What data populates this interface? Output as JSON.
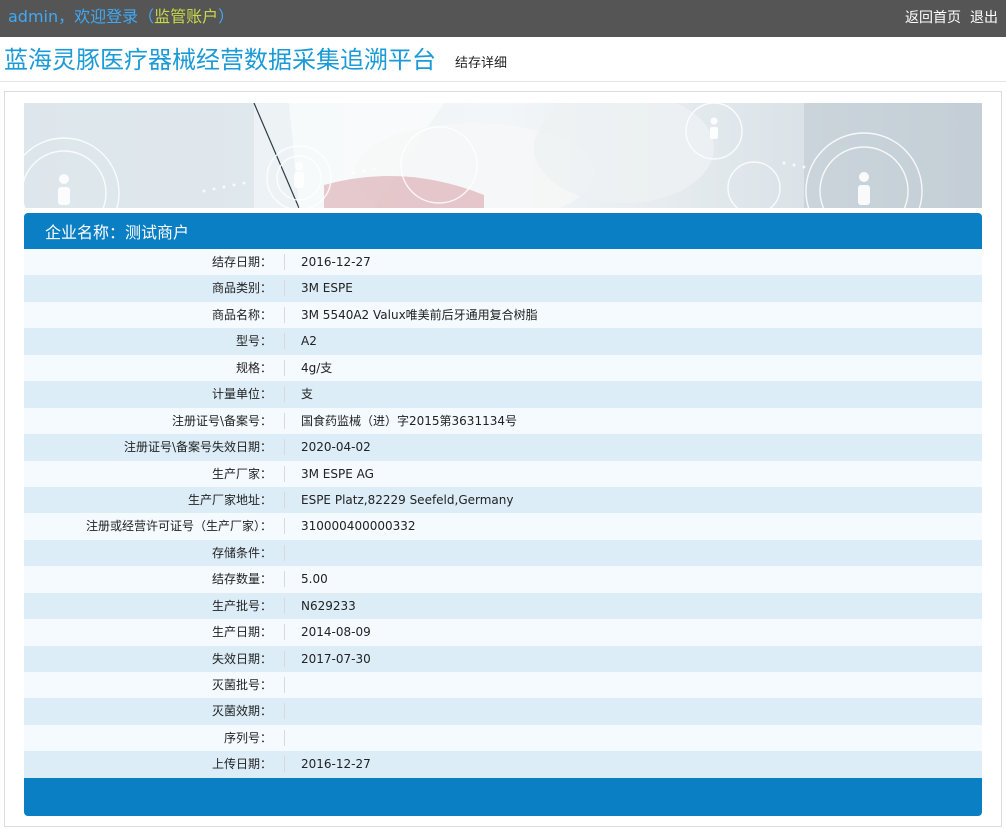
{
  "header": {
    "user": "admin",
    "welcome": "，欢迎登录（",
    "role": "监管账户",
    "role_close": "）",
    "home_link": "返回首页",
    "logout_link": "退出"
  },
  "title": {
    "site": "蓝海灵豚医疗器械经营数据采集追溯平台",
    "page": "结存详细"
  },
  "banner": {
    "icon": "person-circle-icon"
  },
  "panel": {
    "company_label": "企业名称：",
    "company_name": "测试商户",
    "rows": [
      {
        "label": "结存日期：",
        "value": "2016-12-27"
      },
      {
        "label": "商品类别：",
        "value": "3M ESPE"
      },
      {
        "label": "商品名称：",
        "value": "3M 5540A2 Valux唯美前后牙通用复合树脂"
      },
      {
        "label": "型号：",
        "value": "A2"
      },
      {
        "label": "规格：",
        "value": "4g/支"
      },
      {
        "label": "计量单位：",
        "value": "支"
      },
      {
        "label": "注册证号\\备案号：",
        "value": "国食药监械（进）字2015第3631134号"
      },
      {
        "label": "注册证号\\备案号失效日期：",
        "value": "2020-04-02"
      },
      {
        "label": "生产厂家：",
        "value": "3M ESPE AG"
      },
      {
        "label": "生产厂家地址：",
        "value": "ESPE Platz,82229 Seefeld,Germany"
      },
      {
        "label": "注册或经营许可证号（生产厂家）：",
        "value": "310000400000332"
      },
      {
        "label": "存储条件：",
        "value": ""
      },
      {
        "label": "结存数量：",
        "value": "5.00"
      },
      {
        "label": "生产批号：",
        "value": "N629233"
      },
      {
        "label": "生产日期：",
        "value": "2014-08-09"
      },
      {
        "label": "失效日期：",
        "value": "2017-07-30"
      },
      {
        "label": "灭菌批号：",
        "value": ""
      },
      {
        "label": "灭菌效期：",
        "value": ""
      },
      {
        "label": "序列号：",
        "value": ""
      },
      {
        "label": "上传日期：",
        "value": "2016-12-27"
      }
    ]
  },
  "colors": {
    "topbar": "#555555",
    "accent": "#1a9ad6",
    "role": "#c7d94a",
    "panel": "#0b7fc4",
    "row_even": "#dcedf8",
    "row_odd": "#f4fafd"
  }
}
